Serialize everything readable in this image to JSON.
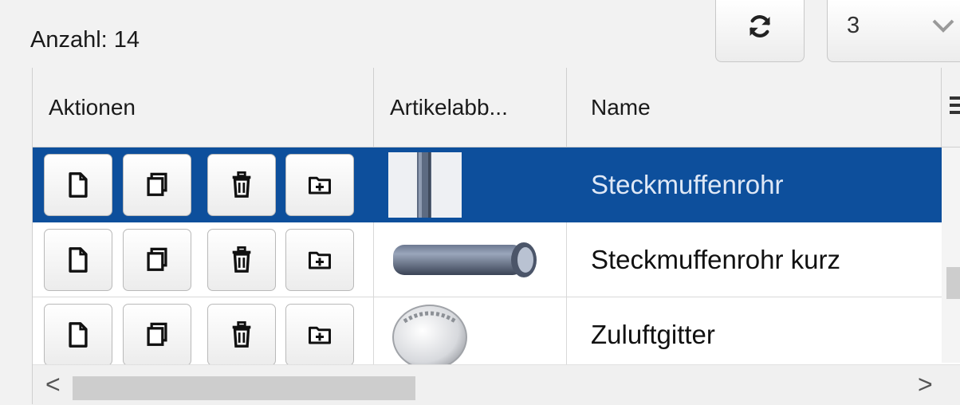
{
  "toolbar": {
    "count_label": "Anzahl: 14",
    "refresh_icon": "refresh-icon",
    "page_size_value": "3",
    "page_size_icon": "chevron-down-icon"
  },
  "grid": {
    "columns": [
      "Aktionen",
      "Artikelabb...",
      "Name"
    ],
    "column_menu_icon": "column-menu-icon",
    "selected_color": "#0d4f9c",
    "action_icons": [
      "new-document-icon",
      "copy-icon",
      "trash-icon",
      "folder-add-icon"
    ],
    "rows": [
      {
        "name": "Steckmuffenrohr",
        "selected": true,
        "image_icon": "pipe-vertical-image"
      },
      {
        "name": "Steckmuffenrohr kurz",
        "selected": false,
        "image_icon": "pipe-horizontal-image"
      },
      {
        "name": "Zuluftgitter",
        "selected": false,
        "image_icon": "air-grille-image"
      }
    ]
  },
  "scrollbars": {
    "left_arrow": "<",
    "right_arrow": ">"
  }
}
